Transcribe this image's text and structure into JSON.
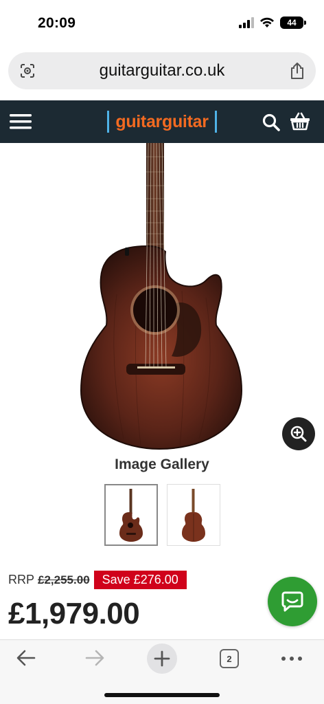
{
  "status": {
    "time": "20:09",
    "battery": "44"
  },
  "browser": {
    "url": "guitarguitar.co.uk",
    "tab_count": "2"
  },
  "site": {
    "logo": "guitarguitar"
  },
  "gallery": {
    "title": "Image Gallery"
  },
  "product": {
    "rrp_label": "RRP",
    "rrp_value": "£2,255.00",
    "save_label": "Save £276.00",
    "price": "£1,979.00"
  },
  "colors": {
    "header_bg": "#1c2a33",
    "logo_orange": "#f26a21",
    "logo_bar_blue": "#4fb3e8",
    "save_red": "#d0021b",
    "chat_green": "#2f9d33"
  },
  "icons": {
    "url_left": "page-settings-icon",
    "url_right": "share-icon",
    "header_left": "hamburger-menu-icon",
    "header_search": "search-icon",
    "header_basket": "basket-icon",
    "zoom": "zoom-in-icon",
    "chat": "chat-icon"
  }
}
